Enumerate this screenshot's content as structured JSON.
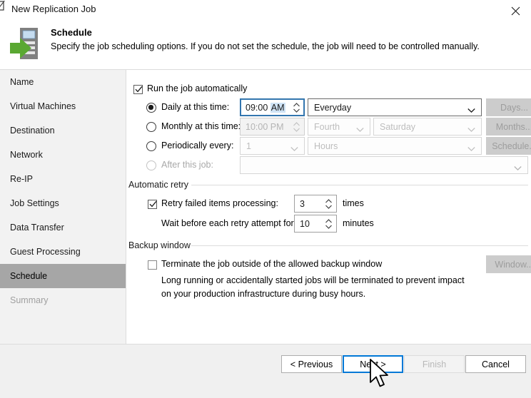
{
  "window": {
    "title": "New Replication Job",
    "close_label": "Close",
    "icon": "replication-job-icon"
  },
  "header": {
    "title": "Schedule",
    "description": "Specify the job scheduling options. If you do not set the schedule, the job will need to be controlled manually.",
    "icon": "schedule-server-arrow-icon"
  },
  "sidebar": {
    "items": [
      {
        "label": "Name",
        "state": "normal"
      },
      {
        "label": "Virtual Machines",
        "state": "normal"
      },
      {
        "label": "Destination",
        "state": "normal"
      },
      {
        "label": "Network",
        "state": "normal"
      },
      {
        "label": "Re-IP",
        "state": "normal"
      },
      {
        "label": "Job Settings",
        "state": "normal"
      },
      {
        "label": "Data Transfer",
        "state": "normal"
      },
      {
        "label": "Guest Processing",
        "state": "normal"
      },
      {
        "label": "Schedule",
        "state": "selected"
      },
      {
        "label": "Summary",
        "state": "disabled"
      }
    ]
  },
  "main": {
    "run_automatically": {
      "label": "Run the job automatically",
      "checked": true
    },
    "schedule_options": [
      {
        "id": "daily",
        "label": "Daily at this time:",
        "selected": true,
        "enabled": true,
        "time_value": "09:00",
        "time_meridiem": "AM",
        "meridiem_selected": true,
        "dropdown_value": "Everyday",
        "button_label": "Days..."
      },
      {
        "id": "monthly",
        "label": "Monthly at this time:",
        "selected": false,
        "enabled": false,
        "time_value": "10:00",
        "time_meridiem": "PM",
        "meridiem_selected": false,
        "ordinal_value": "Fourth",
        "weekday_value": "Saturday",
        "button_label": "Months..."
      },
      {
        "id": "periodically",
        "label": "Periodically every:",
        "selected": false,
        "enabled": false,
        "interval_value": "1",
        "unit_value": "Hours",
        "button_label": "Schedule..."
      },
      {
        "id": "after_job",
        "label": "After this job:",
        "selected": false,
        "enabled": false,
        "dropdown_value": ""
      }
    ],
    "automatic_retry": {
      "group_label": "Automatic retry",
      "retry_checkbox_label": "Retry failed items processing:",
      "retry_checked": true,
      "retry_times_value": "3",
      "retry_times_suffix": "times",
      "wait_label": "Wait before each retry attempt for:",
      "wait_value": "10",
      "wait_suffix": "minutes"
    },
    "backup_window": {
      "group_label": "Backup window",
      "terminate_checkbox_label": "Terminate the job outside of the allowed backup window",
      "terminate_checked": false,
      "description_line1": "Long running or accidentally started jobs will be terminated to prevent impact",
      "description_line2": "on your production infrastructure during busy hours.",
      "window_button_label": "Window..."
    }
  },
  "footer": {
    "previous_label": "< Previous",
    "next_label": "Next >",
    "finish_label": "Finish",
    "cancel_label": "Cancel",
    "next_focused": true,
    "finish_enabled": false
  },
  "colors": {
    "accent": "#0078d7",
    "selection": "#cfe3f5",
    "sidebar_selected": "#a6a6a6",
    "icon_green": "#5aa832",
    "chrome": "#f0f0f0"
  }
}
